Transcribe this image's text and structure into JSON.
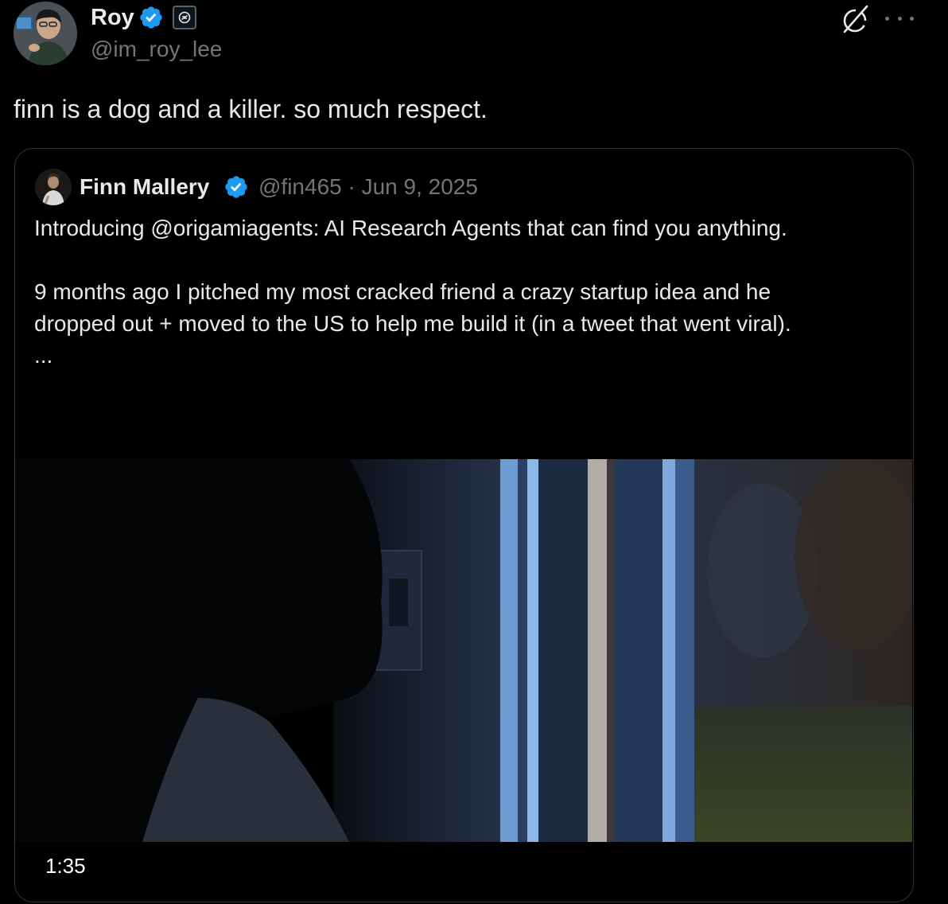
{
  "author": {
    "name": "Roy",
    "handle": "@im_roy_lee"
  },
  "tweet": {
    "text": "finn is a dog and a killer. so much respect."
  },
  "quoted": {
    "name": "Finn Mallery",
    "handle": "@fin465",
    "date": "Jun 9, 2025",
    "meta": "@fin465 · Jun 9, 2025",
    "lines": [
      "Introducing @origamiagents: AI Research Agents that can find you anything.",
      "9 months ago I pitched my most cracked friend a crazy startup idea and he",
      "dropped out + moved to the US to help me build it (in a tweet that went viral).",
      "..."
    ],
    "video": {
      "duration": "1:35"
    }
  },
  "icons": {
    "verified": "verified-badge-icon",
    "affiliation": "affiliate-badge-icon",
    "grok": "grok-icon",
    "more": "more-options-icon"
  },
  "colors": {
    "verified": "#1d9bf0",
    "secondary_text": "#71767b",
    "primary_text": "#e7e9ea",
    "border": "#2f3336"
  }
}
